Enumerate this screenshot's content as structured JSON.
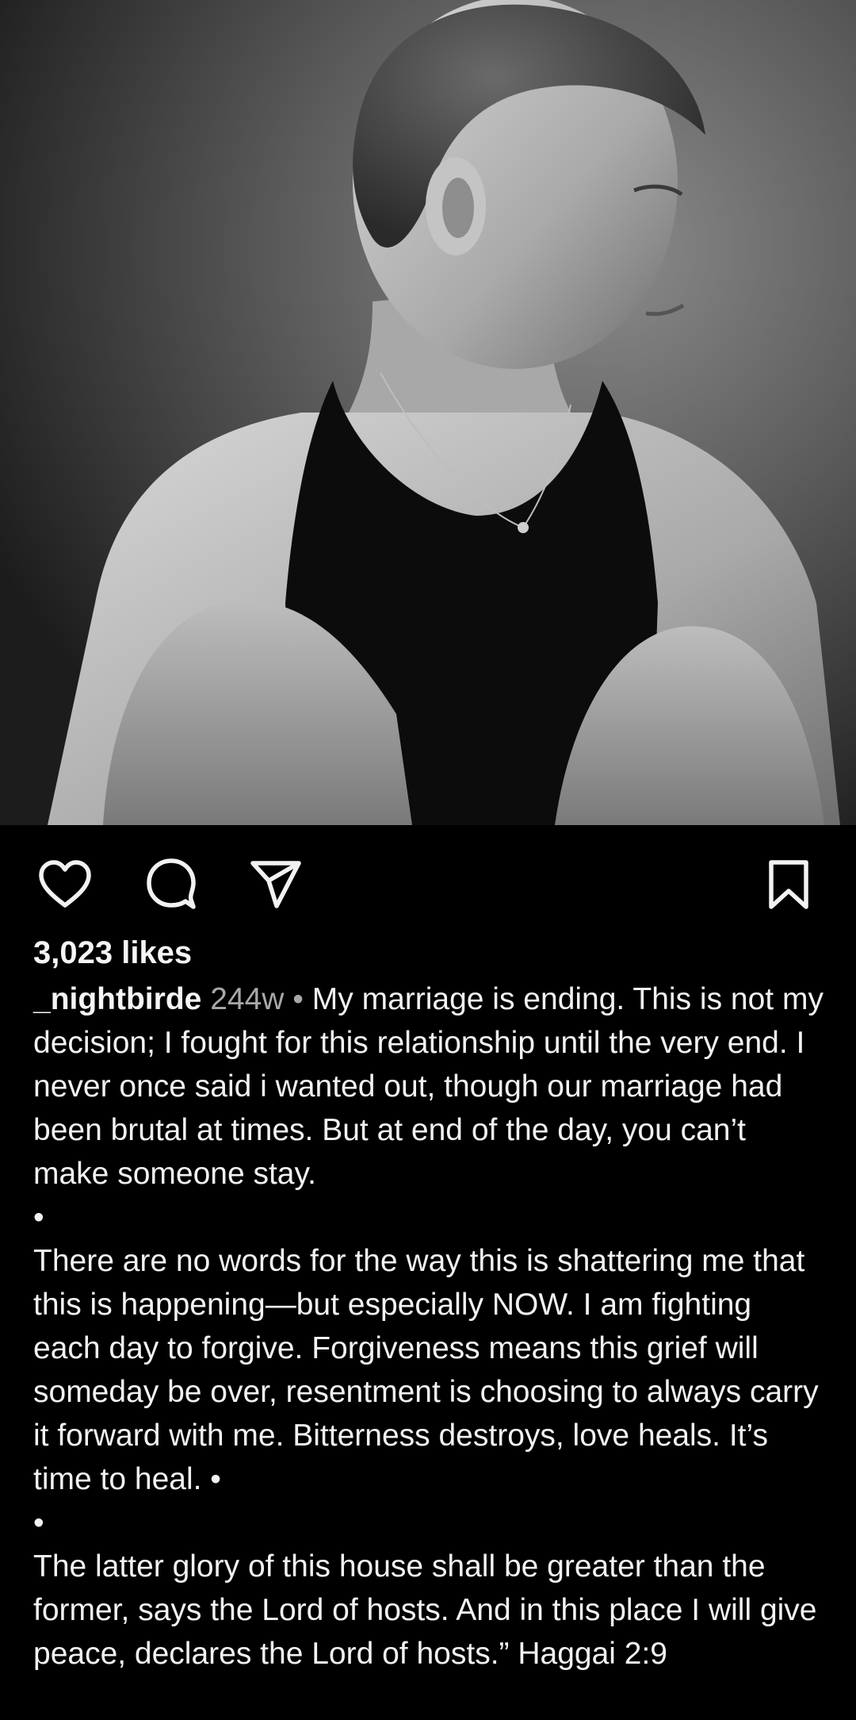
{
  "post": {
    "image_alt": "black-and-white portrait photograph",
    "likes": "3,023 likes",
    "username": "_nightbirde",
    "time_ago": "244w",
    "separator": "•",
    "caption_paragraphs": [
      "My marriage is ending. This is not my decision; I fought for this relationship until the very end. I never once said i wanted out, though our marriage had been brutal at times. But at end of the day, you can’t make someone stay.",
      "•",
      "There are no words for the way this is shattering me that this is happening—but especially NOW. I am fighting each day to forgive. Forgiveness means this grief will someday be over, resentment is choosing to always carry it forward with me. Bitterness destroys, love heals. It’s time to heal. •",
      "•",
      "The latter glory of this house shall be greater than the former, says the Lord of hosts. And in this place I will give peace, declares the Lord of hosts.” Haggai 2:9"
    ]
  },
  "actions": {
    "like_icon": "heart-outline-icon",
    "comment_icon": "comment-bubble-icon",
    "share_icon": "paper-plane-icon",
    "save_icon": "bookmark-outline-icon"
  },
  "colors": {
    "background": "#000000",
    "text": "#f2f2f2",
    "muted": "#a8a8a8"
  }
}
